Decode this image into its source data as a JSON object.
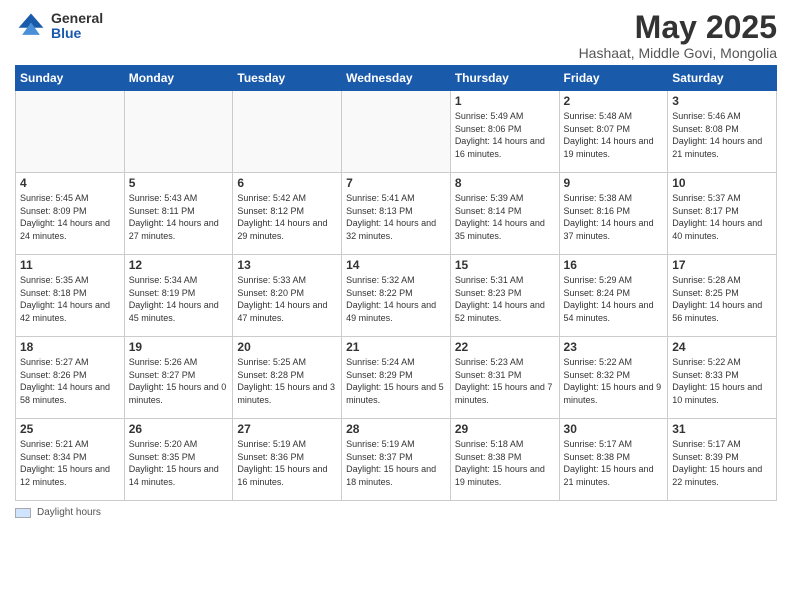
{
  "logo": {
    "general": "General",
    "blue": "Blue"
  },
  "title": "May 2025",
  "subtitle": "Hashaat, Middle Govi, Mongolia",
  "days_of_week": [
    "Sunday",
    "Monday",
    "Tuesday",
    "Wednesday",
    "Thursday",
    "Friday",
    "Saturday"
  ],
  "weeks": [
    [
      {
        "day": "",
        "info": ""
      },
      {
        "day": "",
        "info": ""
      },
      {
        "day": "",
        "info": ""
      },
      {
        "day": "",
        "info": ""
      },
      {
        "day": "1",
        "info": "Sunrise: 5:49 AM\nSunset: 8:06 PM\nDaylight: 14 hours and 16 minutes."
      },
      {
        "day": "2",
        "info": "Sunrise: 5:48 AM\nSunset: 8:07 PM\nDaylight: 14 hours and 19 minutes."
      },
      {
        "day": "3",
        "info": "Sunrise: 5:46 AM\nSunset: 8:08 PM\nDaylight: 14 hours and 21 minutes."
      }
    ],
    [
      {
        "day": "4",
        "info": "Sunrise: 5:45 AM\nSunset: 8:09 PM\nDaylight: 14 hours and 24 minutes."
      },
      {
        "day": "5",
        "info": "Sunrise: 5:43 AM\nSunset: 8:11 PM\nDaylight: 14 hours and 27 minutes."
      },
      {
        "day": "6",
        "info": "Sunrise: 5:42 AM\nSunset: 8:12 PM\nDaylight: 14 hours and 29 minutes."
      },
      {
        "day": "7",
        "info": "Sunrise: 5:41 AM\nSunset: 8:13 PM\nDaylight: 14 hours and 32 minutes."
      },
      {
        "day": "8",
        "info": "Sunrise: 5:39 AM\nSunset: 8:14 PM\nDaylight: 14 hours and 35 minutes."
      },
      {
        "day": "9",
        "info": "Sunrise: 5:38 AM\nSunset: 8:16 PM\nDaylight: 14 hours and 37 minutes."
      },
      {
        "day": "10",
        "info": "Sunrise: 5:37 AM\nSunset: 8:17 PM\nDaylight: 14 hours and 40 minutes."
      }
    ],
    [
      {
        "day": "11",
        "info": "Sunrise: 5:35 AM\nSunset: 8:18 PM\nDaylight: 14 hours and 42 minutes."
      },
      {
        "day": "12",
        "info": "Sunrise: 5:34 AM\nSunset: 8:19 PM\nDaylight: 14 hours and 45 minutes."
      },
      {
        "day": "13",
        "info": "Sunrise: 5:33 AM\nSunset: 8:20 PM\nDaylight: 14 hours and 47 minutes."
      },
      {
        "day": "14",
        "info": "Sunrise: 5:32 AM\nSunset: 8:22 PM\nDaylight: 14 hours and 49 minutes."
      },
      {
        "day": "15",
        "info": "Sunrise: 5:31 AM\nSunset: 8:23 PM\nDaylight: 14 hours and 52 minutes."
      },
      {
        "day": "16",
        "info": "Sunrise: 5:29 AM\nSunset: 8:24 PM\nDaylight: 14 hours and 54 minutes."
      },
      {
        "day": "17",
        "info": "Sunrise: 5:28 AM\nSunset: 8:25 PM\nDaylight: 14 hours and 56 minutes."
      }
    ],
    [
      {
        "day": "18",
        "info": "Sunrise: 5:27 AM\nSunset: 8:26 PM\nDaylight: 14 hours and 58 minutes."
      },
      {
        "day": "19",
        "info": "Sunrise: 5:26 AM\nSunset: 8:27 PM\nDaylight: 15 hours and 0 minutes."
      },
      {
        "day": "20",
        "info": "Sunrise: 5:25 AM\nSunset: 8:28 PM\nDaylight: 15 hours and 3 minutes."
      },
      {
        "day": "21",
        "info": "Sunrise: 5:24 AM\nSunset: 8:29 PM\nDaylight: 15 hours and 5 minutes."
      },
      {
        "day": "22",
        "info": "Sunrise: 5:23 AM\nSunset: 8:31 PM\nDaylight: 15 hours and 7 minutes."
      },
      {
        "day": "23",
        "info": "Sunrise: 5:22 AM\nSunset: 8:32 PM\nDaylight: 15 hours and 9 minutes."
      },
      {
        "day": "24",
        "info": "Sunrise: 5:22 AM\nSunset: 8:33 PM\nDaylight: 15 hours and 10 minutes."
      }
    ],
    [
      {
        "day": "25",
        "info": "Sunrise: 5:21 AM\nSunset: 8:34 PM\nDaylight: 15 hours and 12 minutes."
      },
      {
        "day": "26",
        "info": "Sunrise: 5:20 AM\nSunset: 8:35 PM\nDaylight: 15 hours and 14 minutes."
      },
      {
        "day": "27",
        "info": "Sunrise: 5:19 AM\nSunset: 8:36 PM\nDaylight: 15 hours and 16 minutes."
      },
      {
        "day": "28",
        "info": "Sunrise: 5:19 AM\nSunset: 8:37 PM\nDaylight: 15 hours and 18 minutes."
      },
      {
        "day": "29",
        "info": "Sunrise: 5:18 AM\nSunset: 8:38 PM\nDaylight: 15 hours and 19 minutes."
      },
      {
        "day": "30",
        "info": "Sunrise: 5:17 AM\nSunset: 8:38 PM\nDaylight: 15 hours and 21 minutes."
      },
      {
        "day": "31",
        "info": "Sunrise: 5:17 AM\nSunset: 8:39 PM\nDaylight: 15 hours and 22 minutes."
      }
    ]
  ],
  "footer": {
    "legend_label": "Daylight hours"
  }
}
